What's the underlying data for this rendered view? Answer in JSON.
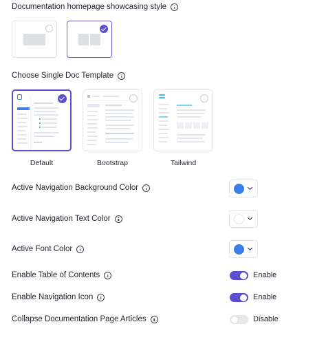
{
  "homepage_style": {
    "label": "Documentation homepage showcasing style",
    "options": [
      {
        "name": "single-block",
        "selected": false
      },
      {
        "name": "two-blocks",
        "selected": true
      }
    ]
  },
  "single_doc_template": {
    "label": "Choose Single Doc Template",
    "options": [
      {
        "name": "Default",
        "selected": true
      },
      {
        "name": "Bootstrap",
        "selected": false
      },
      {
        "name": "Tailwind",
        "selected": false
      }
    ]
  },
  "settings": {
    "active_nav_bg": {
      "label": "Active Navigation Background Color",
      "color": "#3b7de9"
    },
    "active_nav_text": {
      "label": "Active Navigation Text Color",
      "color": "#ffffff"
    },
    "active_font": {
      "label": "Active Font Color",
      "color": "#3b7de9"
    },
    "toc": {
      "label": "Enable Table of Contents",
      "state": "Enable",
      "on": true
    },
    "nav_icon": {
      "label": "Enable Navigation Icon",
      "state": "Enable",
      "on": true
    },
    "collapse": {
      "label": "Collapse Documentation Page Articles",
      "state": "Disable",
      "on": false
    }
  },
  "colors": {
    "accent": "#5b4fd0",
    "picker_blue": "#3b7de9"
  }
}
